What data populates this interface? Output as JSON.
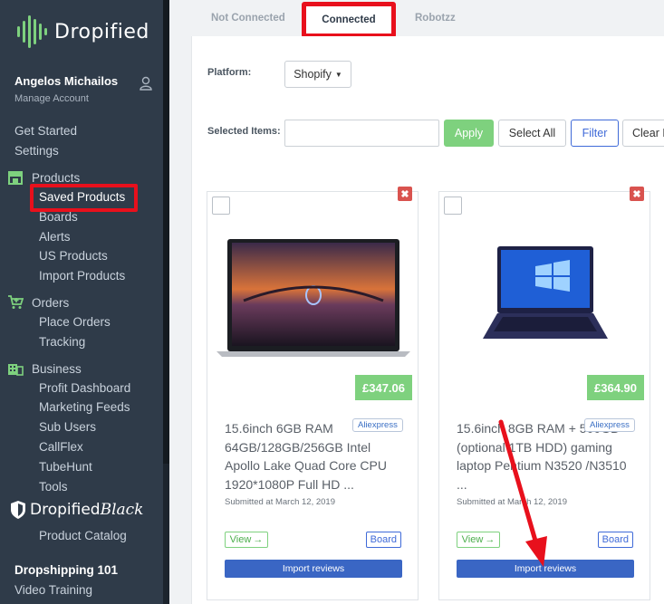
{
  "app": {
    "logo_text": "Dropified",
    "brand_color": "#7ed17e",
    "sidebar_bg": "#2f3b49",
    "highlight_color": "#e8101c"
  },
  "user": {
    "name": "Angelos Michailos",
    "manage": "Manage Account"
  },
  "sidebar": {
    "get_started": "Get Started",
    "settings": "Settings",
    "products": {
      "label": "Products",
      "icon": "store-icon",
      "items": [
        "Saved Products",
        "Boards",
        "Alerts",
        "US Products",
        "Import Products"
      ]
    },
    "orders": {
      "label": "Orders",
      "icon": "cart-icon",
      "items": [
        "Place Orders",
        "Tracking"
      ]
    },
    "business": {
      "label": "Business",
      "icon": "building-icon",
      "items": [
        "Profit Dashboard",
        "Marketing Feeds",
        "Sub Users",
        "CallFlex",
        "TubeHunt",
        "Tools"
      ]
    },
    "black_logo": {
      "part1": "Dropified",
      "part2": "Black"
    },
    "product_catalog": "Product Catalog",
    "dropshipping": "Dropshipping 101",
    "video_training": "Video Training"
  },
  "tabs": [
    "Not Connected",
    "Connected",
    "Robotzz"
  ],
  "filters": {
    "platform_label": "Platform:",
    "platform_value": "Shopify",
    "selected_label": "Selected Items:",
    "apply": "Apply",
    "select_all": "Select All",
    "filter": "Filter",
    "clear": "Clear F"
  },
  "products": [
    {
      "price": "£347.06",
      "title": "15.6inch 6GB RAM 64GB/128GB/256GB Intel Apollo Lake Quad Core CPU 1920*1080P Full HD ...",
      "source": "Aliexpress",
      "submitted": "Submitted at March 12, 2019",
      "view": "View",
      "board": "Board",
      "import": "Import reviews"
    },
    {
      "price": "£364.90",
      "title": "15.6inch 8GB RAM + 500GB (optional 1TB HDD) gaming laptop Pentium N3520 /N3510 ...",
      "source": "Aliexpress",
      "submitted": "Submitted at March 12, 2019",
      "view": "View",
      "board": "Board",
      "import": "Import reviews"
    }
  ]
}
